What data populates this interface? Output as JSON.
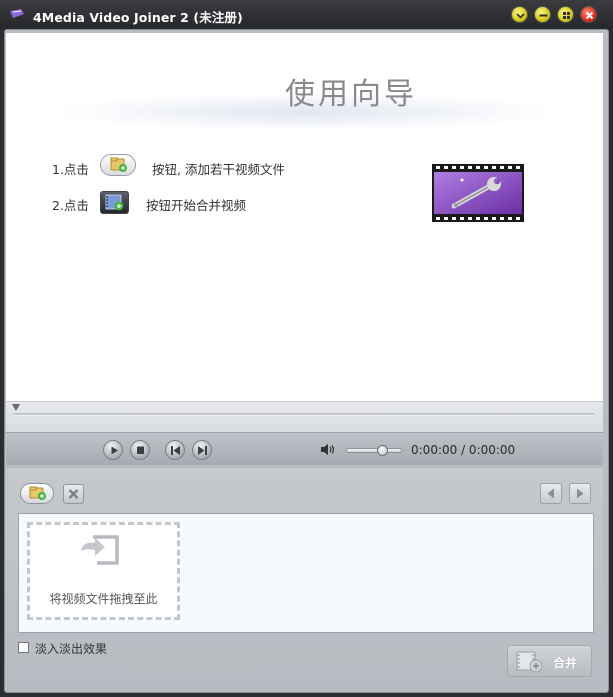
{
  "window": {
    "title": "4Media Video Joiner 2 (未注册)"
  },
  "guide": {
    "title": "使用向导",
    "step1_prefix": "1.点击",
    "step1_text": "按钮, 添加若干视频文件",
    "step2_prefix": "2.点击",
    "step2_text": "按钮开始合并视频"
  },
  "player": {
    "time": "0:00:00 / 0:00:00",
    "seek_progress": 0,
    "volume_level": 0.62
  },
  "file_list": {
    "drop_hint": "将视频文件拖拽至此"
  },
  "options": {
    "fade_label": "淡入淡出效果",
    "fade_checked": false
  },
  "actions": {
    "merge_label": "合并"
  },
  "colors": {
    "accent_purple": "#7a3fb8",
    "add_green": "#3fb83a",
    "title_bar": "#2b2d31"
  }
}
